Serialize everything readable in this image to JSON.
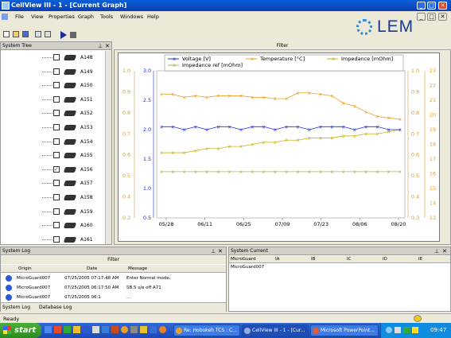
{
  "window": {
    "title": "CellView III - 1 - [Current Graph]"
  },
  "menu": [
    "File",
    "View",
    "Properties",
    "Graph",
    "Tools",
    "Windows",
    "Help"
  ],
  "logo": "LEM",
  "system_tree": {
    "title": "System Tree",
    "items": [
      {
        "label": "A148",
        "checked": false
      },
      {
        "label": "A149",
        "checked": false
      },
      {
        "label": "A150",
        "checked": false
      },
      {
        "label": "A151",
        "checked": false
      },
      {
        "label": "A152",
        "checked": false
      },
      {
        "label": "A153",
        "checked": false
      },
      {
        "label": "A154",
        "checked": false
      },
      {
        "label": "A155",
        "checked": false
      },
      {
        "label": "A156",
        "checked": true
      },
      {
        "label": "A157",
        "checked": false
      },
      {
        "label": "A158",
        "checked": false
      },
      {
        "label": "A159",
        "checked": false
      },
      {
        "label": "A160",
        "checked": false
      },
      {
        "label": "A161",
        "checked": false
      }
    ]
  },
  "graph": {
    "filter_label": "Filter"
  },
  "chart_data": {
    "type": "line",
    "x_ticks": [
      "05/28",
      "06/11",
      "06/25",
      "07/09",
      "07/23",
      "08/06",
      "08/20"
    ],
    "series": [
      {
        "name": "Voltage [V]",
        "color": "#1f2fd0",
        "axis": "left_inner"
      },
      {
        "name": "Temperature [°C]",
        "color": "#e8a028",
        "axis": "right_outer"
      },
      {
        "name": "Impedance [mOhm]",
        "color": "#c8b020",
        "axis": "right_inner"
      },
      {
        "name": "Impedance ref [mOhm]",
        "color": "#a8b848",
        "axis": "right_inner"
      }
    ],
    "left_outer_ticks": [
      "1.0",
      "0.9",
      "0.8",
      "0.7",
      "0.6",
      "0.5",
      "0.4",
      "0.3"
    ],
    "left_inner_ticks": [
      "3.0",
      "2.5",
      "2.0",
      "1.5",
      "1.0",
      "0.5"
    ],
    "right_inner_ticks": [
      "1.0",
      "0.9",
      "0.8",
      "0.7",
      "0.6",
      "0.5",
      "0.4",
      "0.3"
    ],
    "right_outer_ticks": [
      "23",
      "22",
      "21",
      "20",
      "19",
      "18",
      "17",
      "16",
      "15",
      "14",
      "13"
    ],
    "voltage_y": [
      2.05,
      2.05,
      2.0,
      2.05,
      2.0,
      2.05,
      2.05,
      2.0,
      2.05,
      2.05,
      2.0,
      2.05,
      2.05,
      2.0,
      2.05,
      2.05,
      2.05,
      2.0,
      2.05,
      2.05,
      2.0,
      2.0
    ],
    "temperature_y": [
      21.4,
      21.4,
      21.2,
      21.3,
      21.2,
      21.3,
      21.3,
      21.3,
      21.2,
      21.2,
      21.1,
      21.1,
      21.5,
      21.5,
      21.4,
      21.3,
      20.8,
      20.6,
      20.2,
      19.9,
      19.8,
      19.7
    ],
    "impedance_y": [
      0.61,
      0.61,
      0.61,
      0.62,
      0.63,
      0.63,
      0.64,
      0.64,
      0.65,
      0.66,
      0.66,
      0.67,
      0.67,
      0.68,
      0.68,
      0.68,
      0.69,
      0.69,
      0.7,
      0.7,
      0.71,
      0.72
    ],
    "impedance_ref_y": [
      0.52,
      0.52,
      0.52,
      0.52,
      0.52,
      0.52,
      0.52,
      0.52,
      0.52,
      0.52,
      0.52,
      0.52,
      0.52,
      0.52,
      0.52,
      0.52,
      0.52,
      0.52,
      0.52,
      0.52,
      0.52,
      0.52
    ]
  },
  "system_log": {
    "title": "System Log",
    "filter_label": "Filter",
    "columns": [
      "Origin",
      "Date",
      "Message"
    ],
    "rows": [
      [
        "MicroGuard007",
        "07/25/2005 07:17:48 AM",
        "Enter Normal mode."
      ],
      [
        "MicroGuard007",
        "07/25/2005 06:17:50 AM",
        "SB.5 s/e off A71"
      ],
      [
        "MicroGuard007",
        "07/25/2005 06:1",
        "..."
      ]
    ]
  },
  "tabs": [
    "System Log",
    "Database Log"
  ],
  "system_current": {
    "title": "System Current",
    "columns": [
      "MicroGuard",
      "IA",
      "IB",
      "IC",
      "ID",
      "IE"
    ],
    "rows": [
      [
        "MicroGuard007",
        "",
        "",
        "",
        "",
        ""
      ]
    ]
  },
  "status": "Ready",
  "taskbar": {
    "start": "start",
    "tasks": [
      "Re: Hobokeh TCS : C...",
      "CellView III - 1 - [Cur...",
      "Microsoft PowerPoint..."
    ],
    "clock": "09:47"
  }
}
